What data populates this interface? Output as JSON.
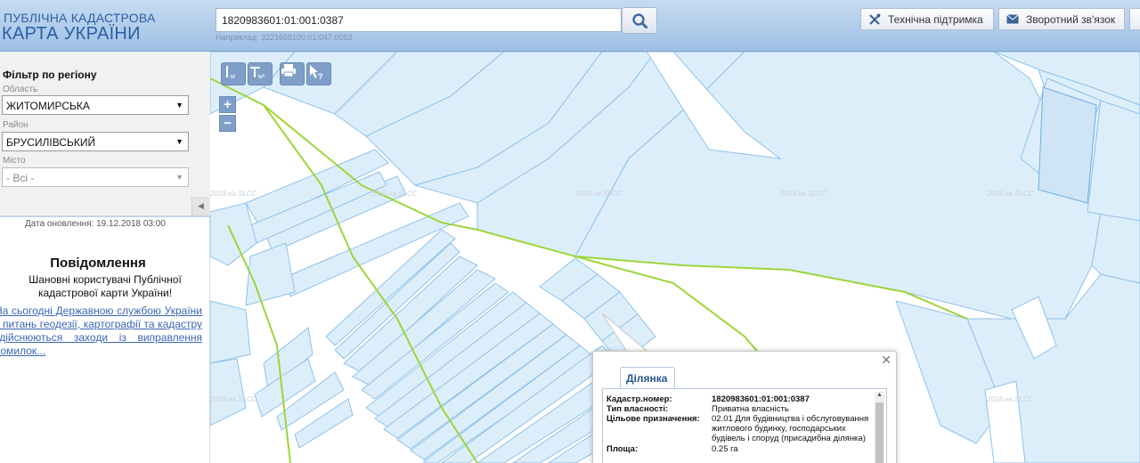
{
  "header": {
    "logo_line1": "ПУБЛІЧНА КАДАСТРОВА",
    "logo_line2": "КАРТА УКРАЇНИ",
    "search_value": "1820983601:01:001:0387",
    "search_example": "Наприклад: 3221655100:01:047:0052",
    "support_label": "Технічна підтримка",
    "feedback_label": "Зворотний зв'язок"
  },
  "sidebar": {
    "filter_title": "Фільтр по регіону",
    "oblast_label": "Область",
    "oblast_value": "ЖИТОМИРСЬКА",
    "rayon_label": "Район",
    "rayon_value": "БРУСИЛІВСЬКИЙ",
    "city_label": "Місто",
    "city_value": "- Всі -",
    "update_date": "Дата оновлення: 19.12.2018 03:00",
    "notice_title": "Повідомлення",
    "notice_greeting": "Шановні користувачі Публічної кадастрової карти України!",
    "notice_text": "На сьогодні Державною службою України з питань геодезії, картографії та кадастру здійснюються заходи із виправлення помилок..."
  },
  "map": {
    "watermark": "2018.на.SLCC",
    "colors": {
      "parcel_fill": "#ddeefb",
      "parcel_stroke": "#8ec2e8",
      "border_line": "#9ed53a"
    }
  },
  "popup": {
    "tab_label": "Ділянка",
    "rows": [
      {
        "key": "Кадастр.номер:",
        "value": "1820983601:01:001:0387"
      },
      {
        "key": "Тип власності:",
        "value": "Приватна власність"
      },
      {
        "key": "Цільове призначення:",
        "value": "02.01 Для будівництва і обслуговування житлового будинку, господарських будівель і споруд (присадибна ділянка)"
      },
      {
        "key": "Площа:",
        "value": "0.25 га"
      }
    ]
  }
}
